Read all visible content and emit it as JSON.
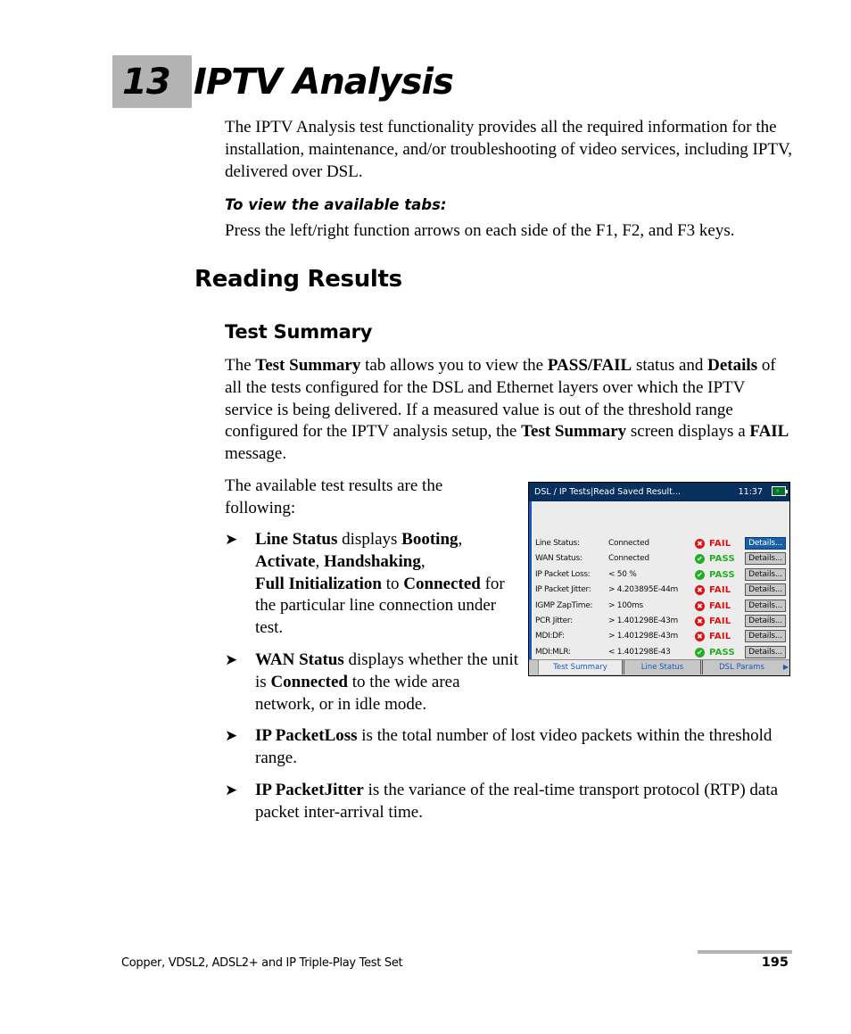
{
  "chapter": {
    "number": "13",
    "title": "IPTV Analysis"
  },
  "intro": {
    "paragraph": "The IPTV Analysis test functionality provides all the required information for the installation, maintenance, and/or troubleshooting of video services, including IPTV, delivered over DSL.",
    "procedure_heading": "To view the available tabs:",
    "procedure_step": "Press the left/right function arrows on each side of the F1, F2, and F3 keys."
  },
  "section": {
    "heading": "Reading Results",
    "subheading": "Test Summary",
    "paragraph": {
      "t1": "The ",
      "b1": "Test Summary",
      "t2": " tab allows you to view the ",
      "b2": "PASS/FAIL",
      "t3": " status and ",
      "b3": "Details",
      "t4": " of all the tests configured for the DSL and Ethernet layers over which the IPTV service is being delivered. If a measured value is out of the threshold range configured for the IPTV analysis setup, the ",
      "b4": "Test Summary",
      "t5": " screen displays a ",
      "b5": "FAIL",
      "t6": " message."
    },
    "list_intro": "The available test results are the following:",
    "bullets": [
      {
        "b1": "Line Status",
        "t1": " displays ",
        "b2": "Booting",
        "t2": ", ",
        "b3": "Activate",
        "t3": ", ",
        "b4": "Handshaking",
        "t4": ", ",
        "b5": "Full Initialization",
        "t5": " to ",
        "b6": "Connected",
        "t6": " for the particular line connection under test."
      },
      {
        "b1": "WAN Status",
        "t1": " displays whether the unit is ",
        "b2": "Connected",
        "t2": " to the wide area network, or in idle mode."
      },
      {
        "b1": "IP PacketLoss",
        "t1": " is the total number of lost video packets within the threshold range."
      },
      {
        "b1": "IP PacketJitter",
        "t1": " is the variance of the real-time transport protocol (RTP) data packet inter-arrival time."
      }
    ],
    "bullet_glyph": "➤"
  },
  "device_screen": {
    "title": "DSL / IP Tests|Read Saved Result...",
    "clock": "11:37",
    "battery_icon": "battery-charging-icon",
    "colors": {
      "titlebar": "#08305f",
      "pass": "#22b022",
      "fail": "#e01010",
      "selected": "#1860a8"
    },
    "rows": [
      {
        "label": "Line Status:",
        "value": "Connected",
        "status": "FAIL",
        "details": "Details..."
      },
      {
        "label": "WAN Status:",
        "value": "Connected",
        "status": "PASS",
        "details": "Details..."
      },
      {
        "label": "IP Packet Loss:",
        "value": "< 50 %",
        "status": "PASS",
        "details": "Details..."
      },
      {
        "label": "IP Packet Jitter:",
        "value": "> 4.203895E-44m",
        "status": "FAIL",
        "details": "Details..."
      },
      {
        "label": "IGMP ZapTime:",
        "value": "> 100ms",
        "status": "FAIL",
        "details": "Details..."
      },
      {
        "label": "PCR Jitter:",
        "value": "> 1.401298E-43m",
        "status": "FAIL",
        "details": "Details..."
      },
      {
        "label": "MDI:DF:",
        "value": "> 1.401298E-43m",
        "status": "FAIL",
        "details": "Details..."
      },
      {
        "label": "MDI:MLR:",
        "value": "<  1.401298E-43",
        "status": "PASS",
        "details": "Details..."
      }
    ],
    "pass_icon_glyph": "✔",
    "fail_icon_glyph": "✖",
    "tabs": [
      {
        "label": "Test Summary",
        "active": true
      },
      {
        "label": "Line Status",
        "active": false
      },
      {
        "label": "DSL Params",
        "active": false
      }
    ],
    "tab_scroll_glyph": "▶"
  },
  "footer": {
    "title": "Copper, VDSL2, ADSL2+ and IP Triple-Play Test Set",
    "page_number": "195"
  }
}
